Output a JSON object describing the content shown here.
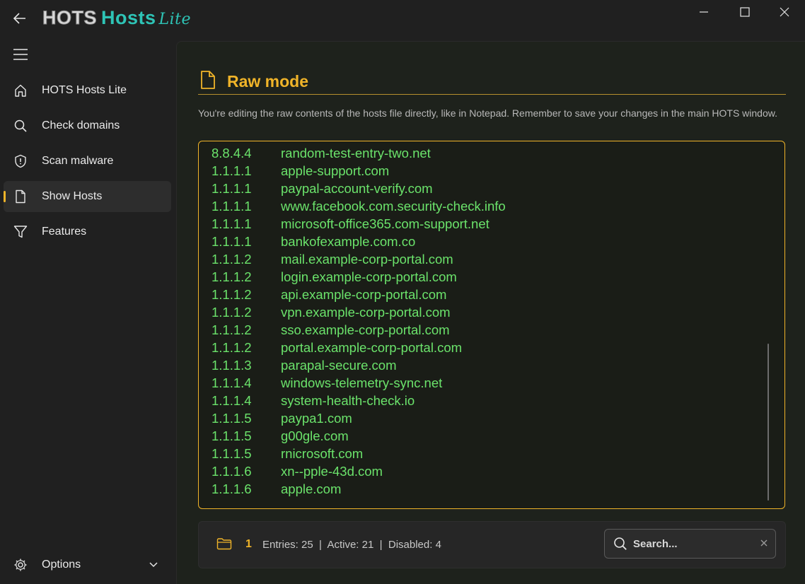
{
  "app": {
    "logo_part1": "HOTS",
    "logo_part2": "Hosts",
    "logo_part3": "Lite",
    "accent_color": "#f0b429",
    "brand_color": "#2ec4b6"
  },
  "sidebar": {
    "items": [
      {
        "label": "HOTS Hosts Lite",
        "icon": "home-icon"
      },
      {
        "label": "Check domains",
        "icon": "search-icon"
      },
      {
        "label": "Scan malware",
        "icon": "shield-icon"
      },
      {
        "label": "Show Hosts",
        "icon": "document-icon",
        "active": true
      },
      {
        "label": "Features",
        "icon": "filter-icon"
      }
    ],
    "options_label": "Options"
  },
  "main": {
    "title": "Raw mode",
    "description": "You're editing the raw contents of the hosts file directly, like in Notepad. Remember to save your changes in the main HOTS window.",
    "entries": [
      {
        "ip": "8.8.4.4",
        "host": "random-test-entry-two.net"
      },
      {
        "ip": "1.1.1.1",
        "host": "apple-support.com"
      },
      {
        "ip": "1.1.1.1",
        "host": "paypal-account-verify.com"
      },
      {
        "ip": "1.1.1.1",
        "host": "www.facebook.com.security-check.info"
      },
      {
        "ip": "1.1.1.1",
        "host": "microsoft-office365.com-support.net"
      },
      {
        "ip": "1.1.1.1",
        "host": "bankofexample.com.co"
      },
      {
        "ip": "1.1.1.2",
        "host": "mail.example-corp-portal.com"
      },
      {
        "ip": "1.1.1.2",
        "host": "login.example-corp-portal.com"
      },
      {
        "ip": "1.1.1.2",
        "host": "api.example-corp-portal.com"
      },
      {
        "ip": "1.1.1.2",
        "host": "vpn.example-corp-portal.com"
      },
      {
        "ip": "1.1.1.2",
        "host": "sso.example-corp-portal.com"
      },
      {
        "ip": "1.1.1.2",
        "host": "portal.example-corp-portal.com"
      },
      {
        "ip": "1.1.1.3",
        "host": "parapal-secure.com"
      },
      {
        "ip": "1.1.1.4",
        "host": "windows-telemetry-sync.net"
      },
      {
        "ip": "1.1.1.4",
        "host": "system-health-check.io"
      },
      {
        "ip": "1.1.1.5",
        "host": "paypa1.com"
      },
      {
        "ip": "1.1.1.5",
        "host": "g00gle.com"
      },
      {
        "ip": "1.1.1.5",
        "host": "rnicrosoft.com"
      },
      {
        "ip": "1.1.1.6",
        "host": "xn--pple-43d.com"
      },
      {
        "ip": "1.1.1.6",
        "host": "apple.com"
      }
    ]
  },
  "status": {
    "count": "1",
    "summary": "Entries: 25  |  Active: 21  |  Disabled: 4"
  },
  "search": {
    "placeholder": "Search..."
  }
}
